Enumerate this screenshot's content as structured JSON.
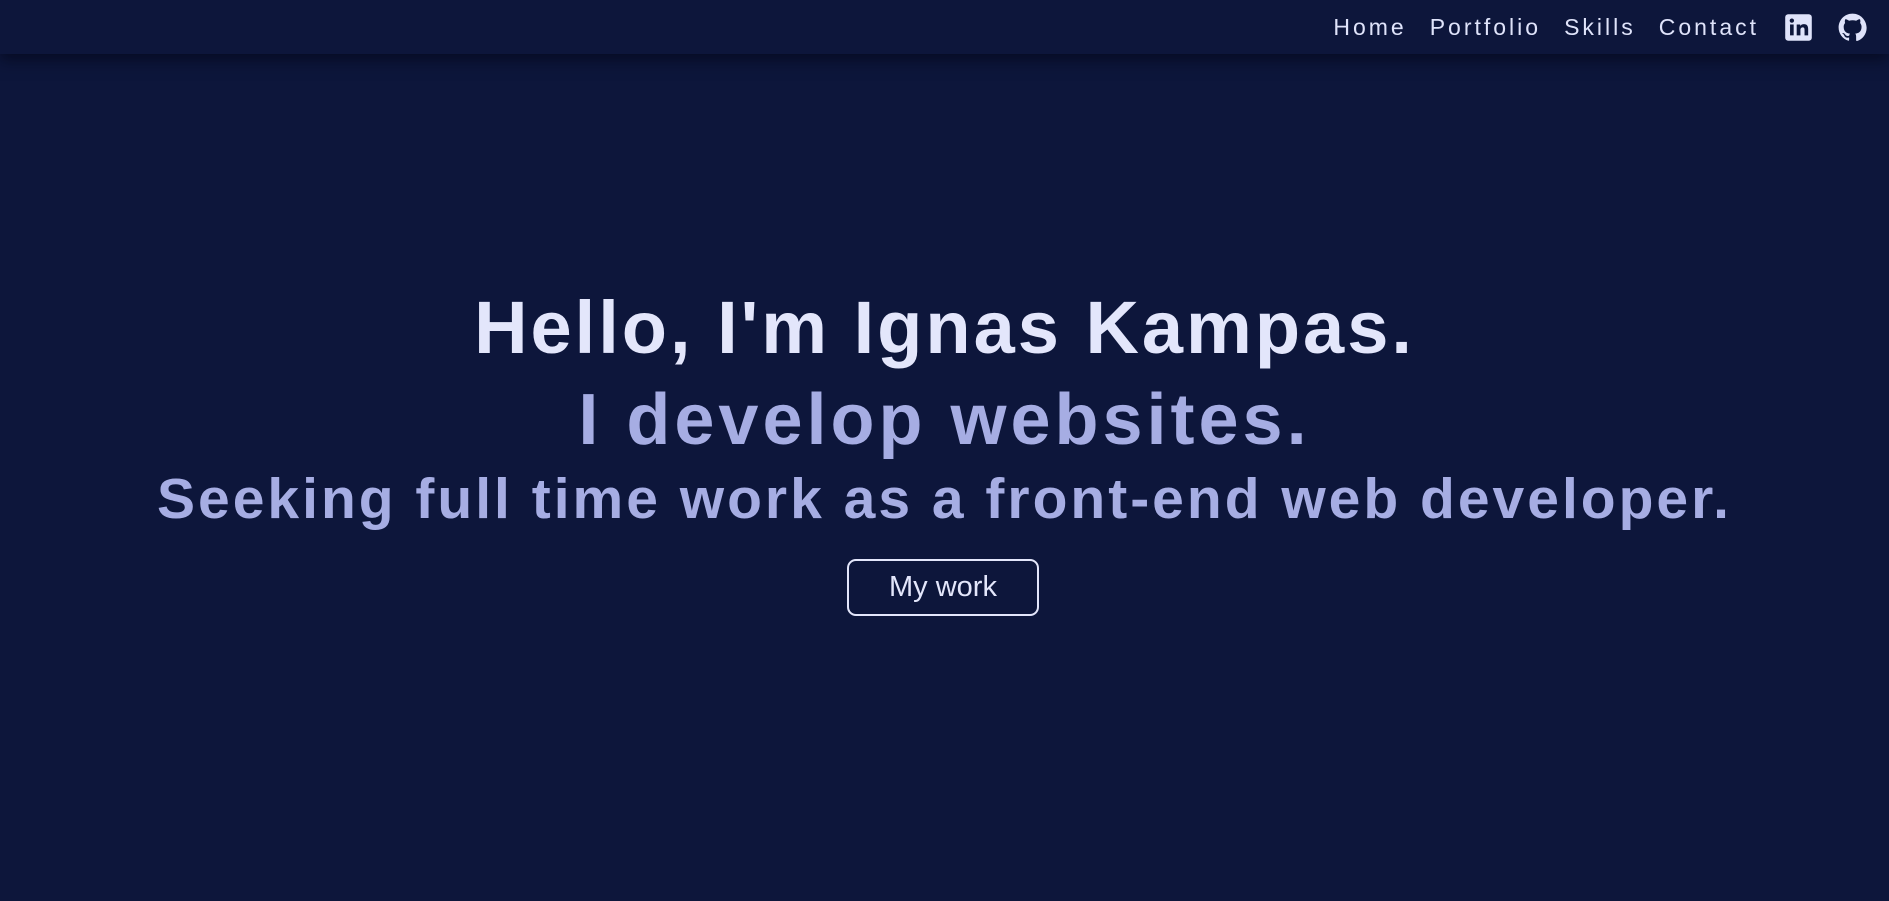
{
  "nav": {
    "links": [
      {
        "label": "Home"
      },
      {
        "label": "Portfolio"
      },
      {
        "label": "Skills"
      },
      {
        "label": "Contact"
      }
    ],
    "icons": [
      "linkedin-icon",
      "github-icon"
    ]
  },
  "hero": {
    "title": "Hello, I'm Ignas Kampas.",
    "subtitle": "I develop websites.",
    "tagline": "Seeking full time work as a front-end web developer.",
    "cta_label": "My work"
  },
  "colors": {
    "background": "#0d163b",
    "title_text": "#e3e6fb",
    "accent_text": "#a6ade3"
  }
}
